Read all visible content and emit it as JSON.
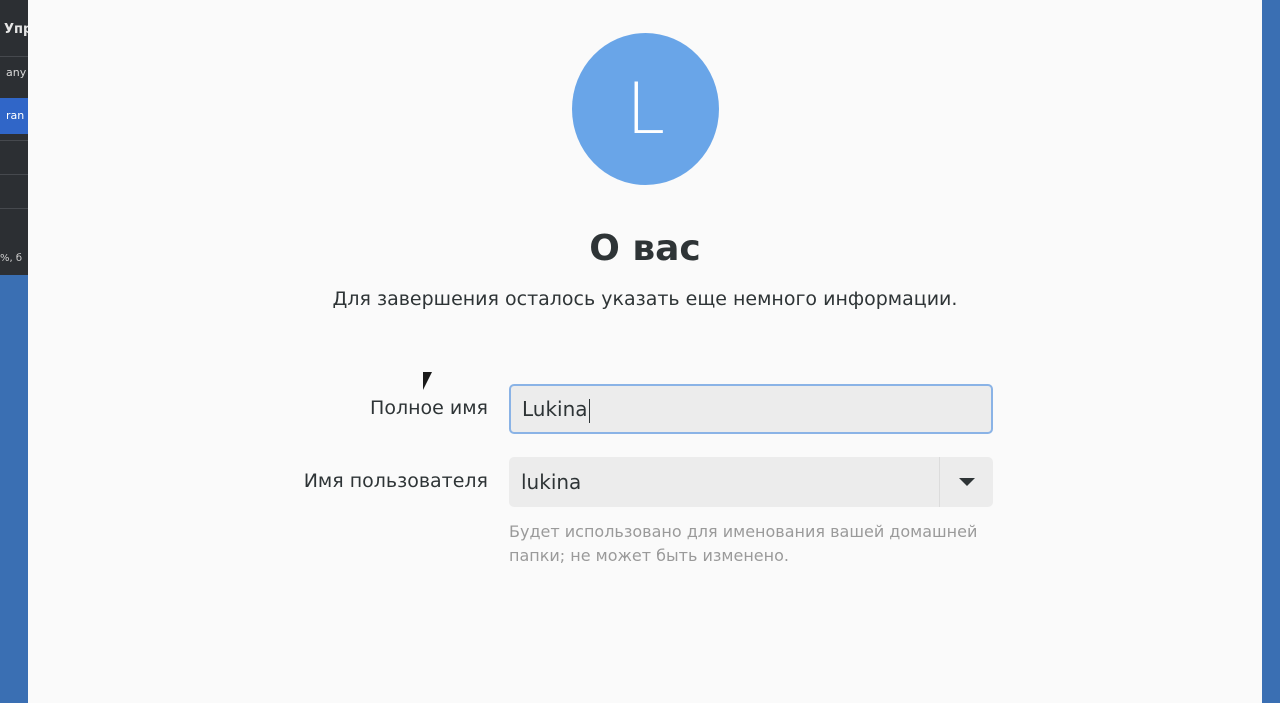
{
  "background_window": {
    "row0": "Упр",
    "row1": "any",
    "row2": "ran",
    "row3": "%, б"
  },
  "dialog": {
    "avatar_letter": "L",
    "title": "О вас",
    "subtitle": "Для завершения осталось указать еще немного информации.",
    "full_name": {
      "label": "Полное имя",
      "value": "Lukina"
    },
    "username": {
      "label": "Имя пользователя",
      "value": "lukina"
    },
    "hint": "Будет использовано для именования вашей домашней папки; не может быть изменено."
  },
  "colors": {
    "avatar": "#69a5e8",
    "focus_border": "#8ab3e6",
    "desktop": "#3a6fb3"
  }
}
